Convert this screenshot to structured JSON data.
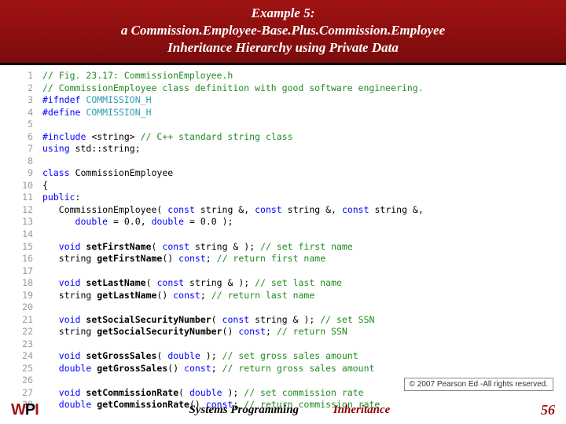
{
  "header": {
    "line1": "Example 5:",
    "line2": "a Commission.Employee-Base.Plus.Commission.Employee",
    "line3": "Inheritance Hierarchy using Private Data"
  },
  "code": {
    "lines": [
      {
        "n": "1",
        "html": "<span class='c-comment'>// Fig. 23.17: CommissionEmployee.h</span>"
      },
      {
        "n": "2",
        "html": "<span class='c-comment'>// CommissionEmployee class definition with good software engineering.</span>"
      },
      {
        "n": "3",
        "html": "<span class='c-preproc'>#ifndef</span> <span class='c-macro'>COMMISSION_H</span>"
      },
      {
        "n": "4",
        "html": "<span class='c-preproc'>#define</span> <span class='c-macro'>COMMISSION_H</span>"
      },
      {
        "n": "5",
        "html": ""
      },
      {
        "n": "6",
        "html": "<span class='c-preproc'>#include</span> <span class='c-plain'>&lt;string&gt;</span> <span class='c-comment'>// C++ standard string class</span>"
      },
      {
        "n": "7",
        "html": "<span class='c-keyword'>using</span> <span class='c-plain'>std::string;</span>"
      },
      {
        "n": "8",
        "html": ""
      },
      {
        "n": "9",
        "html": "<span class='c-keyword'>class</span> <span class='c-plain'>CommissionEmployee</span>"
      },
      {
        "n": "10",
        "html": "<span class='c-plain'>{</span>"
      },
      {
        "n": "11",
        "html": "<span class='c-keyword'>public</span><span class='c-plain'>:</span>"
      },
      {
        "n": "12",
        "html": "   <span class='c-plain'>CommissionEmployee(</span> <span class='c-keyword'>const</span> <span class='c-plain'>string &amp;,</span> <span class='c-keyword'>const</span> <span class='c-plain'>string &amp;,</span> <span class='c-keyword'>const</span> <span class='c-plain'>string &amp;,</span>"
      },
      {
        "n": "13",
        "html": "      <span class='c-keyword'>double</span> <span class='c-plain'>=</span> <span class='c-num'>0.0</span><span class='c-plain'>,</span> <span class='c-keyword'>double</span> <span class='c-plain'>=</span> <span class='c-num'>0.0</span> <span class='c-plain'>);</span>"
      },
      {
        "n": "14",
        "html": ""
      },
      {
        "n": "15",
        "html": "   <span class='c-keyword'>void</span> <span class='c-func'>setFirstName</span><span class='c-plain'>(</span> <span class='c-keyword'>const</span> <span class='c-plain'>string &amp; );</span> <span class='c-comment'>// set first name</span>"
      },
      {
        "n": "16",
        "html": "   <span class='c-plain'>string</span> <span class='c-func'>getFirstName</span><span class='c-plain'>()</span> <span class='c-keyword'>const</span><span class='c-plain'>;</span> <span class='c-comment'>// return first name</span>"
      },
      {
        "n": "17",
        "html": ""
      },
      {
        "n": "18",
        "html": "   <span class='c-keyword'>void</span> <span class='c-func'>setLastName</span><span class='c-plain'>(</span> <span class='c-keyword'>const</span> <span class='c-plain'>string &amp; );</span> <span class='c-comment'>// set last name</span>"
      },
      {
        "n": "19",
        "html": "   <span class='c-plain'>string</span> <span class='c-func'>getLastName</span><span class='c-plain'>()</span> <span class='c-keyword'>const</span><span class='c-plain'>;</span> <span class='c-comment'>// return last name</span>"
      },
      {
        "n": "20",
        "html": ""
      },
      {
        "n": "21",
        "html": "   <span class='c-keyword'>void</span> <span class='c-func'>setSocialSecurityNumber</span><span class='c-plain'>(</span> <span class='c-keyword'>const</span> <span class='c-plain'>string &amp; );</span> <span class='c-comment'>// set SSN</span>"
      },
      {
        "n": "22",
        "html": "   <span class='c-plain'>string</span> <span class='c-func'>getSocialSecurityNumber</span><span class='c-plain'>()</span> <span class='c-keyword'>const</span><span class='c-plain'>;</span> <span class='c-comment'>// return SSN</span>"
      },
      {
        "n": "23",
        "html": ""
      },
      {
        "n": "24",
        "html": "   <span class='c-keyword'>void</span> <span class='c-func'>setGrossSales</span><span class='c-plain'>(</span> <span class='c-keyword'>double</span> <span class='c-plain'>);</span> <span class='c-comment'>// set gross sales amount</span>"
      },
      {
        "n": "25",
        "html": "   <span class='c-keyword'>double</span> <span class='c-func'>getGrossSales</span><span class='c-plain'>()</span> <span class='c-keyword'>const</span><span class='c-plain'>;</span> <span class='c-comment'>// return gross sales amount</span>"
      },
      {
        "n": "26",
        "html": ""
      },
      {
        "n": "27",
        "html": "   <span class='c-keyword'>void</span> <span class='c-func'>setCommissionRate</span><span class='c-plain'>(</span> <span class='c-keyword'>double</span> <span class='c-plain'>);</span> <span class='c-comment'>// set commission rate</span>"
      },
      {
        "n": "28",
        "html": "   <span class='c-keyword'>double</span> <span class='c-func'>getCommissionRate</span><span class='c-plain'>()</span> <span class='c-keyword'>const</span><span class='c-plain'>;</span> <span class='c-comment'>// return commission rate</span>"
      }
    ]
  },
  "footer": {
    "systems": "Systems Programming",
    "inheritance": "Inheritance",
    "page": "56"
  },
  "copyright": "© 2007 Pearson Ed -All rights reserved.",
  "logo": {
    "w": "W",
    "p": "P",
    "i": "I"
  }
}
